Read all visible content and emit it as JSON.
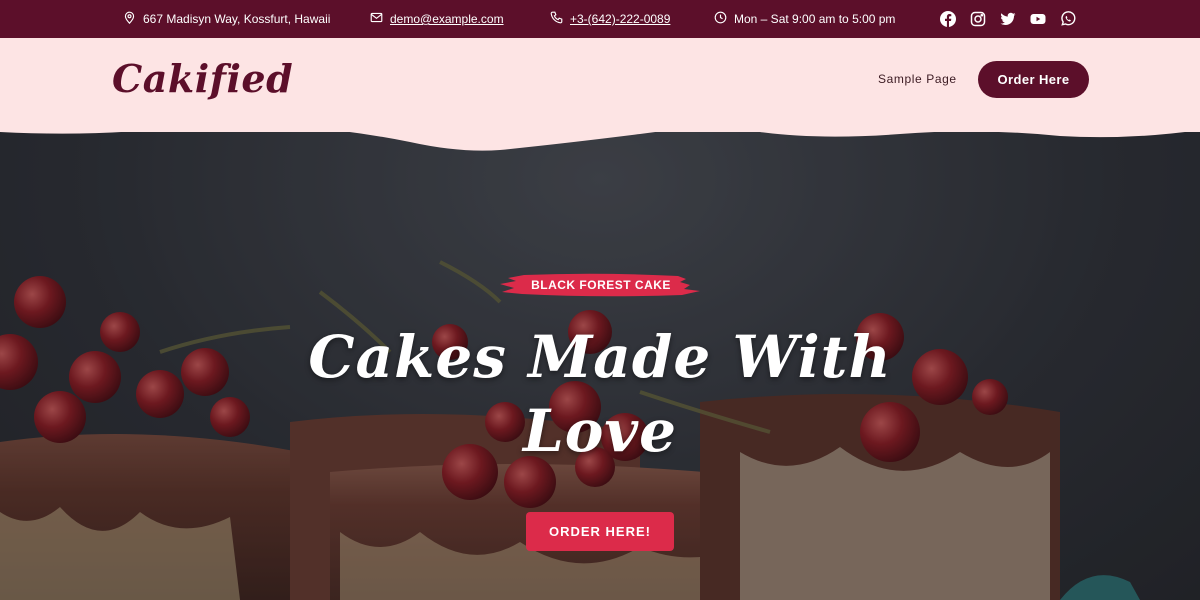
{
  "topbar": {
    "address": "667 Madisyn Way, Kossfurt, Hawaii",
    "email": "demo@example.com",
    "phone": "+3-(642)-222-0089",
    "hours": "Mon – Sat 9:00 am to 5:00 pm",
    "icons": {
      "address": "location-pin-icon",
      "email": "envelope-icon",
      "phone": "phone-icon",
      "hours": "clock-icon"
    },
    "social": [
      "facebook-icon",
      "instagram-icon",
      "twitter-icon",
      "youtube-icon",
      "whatsapp-icon"
    ]
  },
  "header": {
    "logo": "Cakified",
    "nav": [
      {
        "label": "Sample Page"
      }
    ],
    "order_button": "Order Here"
  },
  "hero": {
    "tag": "BLACK FOREST CAKE",
    "headline": "Cakes Made With Love",
    "cta": "ORDER HERE!"
  },
  "colors": {
    "topbar_bg": "#5c0f2a",
    "header_bg": "#fde4e4",
    "brand": "#5c0f2a",
    "accent": "#dc2b4a"
  }
}
